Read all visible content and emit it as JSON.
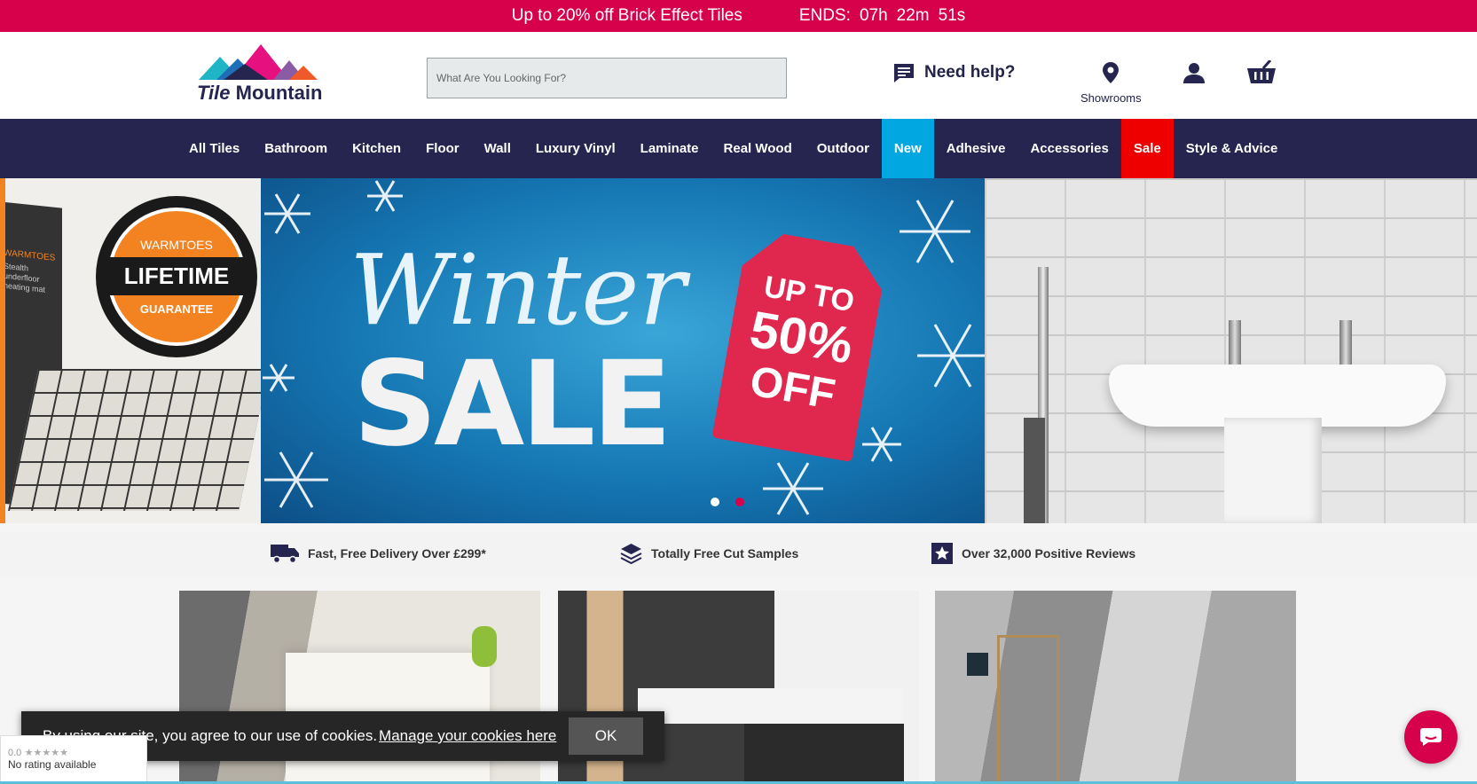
{
  "promo": {
    "text": "Up to 20% off Brick Effect Tiles",
    "ends_label": "ENDS:",
    "hours": "07h",
    "minutes": "22m",
    "seconds": "51s",
    "background": "#d6004b"
  },
  "header": {
    "logo_word1": "Tile",
    "logo_word2": "Mountain",
    "search_placeholder": "What Are You Looking For?",
    "help_label": "Need help?",
    "showrooms_label": "Showrooms",
    "icons": [
      "chat-icon",
      "map-pin-icon",
      "user-icon",
      "basket-icon"
    ]
  },
  "nav": {
    "items": [
      "All Tiles",
      "Bathroom",
      "Kitchen",
      "Floor",
      "Wall",
      "Luxury Vinyl",
      "Laminate",
      "Real Wood",
      "Outdoor",
      "New",
      "Adhesive",
      "Accessories",
      "Sale",
      "Style & Advice"
    ],
    "background": "#252550",
    "new_color": "#00a7e1",
    "sale_color": "#ee0000"
  },
  "hero": {
    "left_slide": {
      "brand": "WARMTOES",
      "badge_main": "LIFETIME",
      "badge_sub": "GUARANTEE",
      "box_brand": "WARMTOES",
      "box_text": "Stealth underfloor heating mat"
    },
    "main_slide": {
      "script": "Winter",
      "headline": "SALE",
      "tag_line1": "UP TO",
      "tag_line2": "50%",
      "tag_line3": "OFF"
    },
    "slide_count": 3,
    "active_index": 1
  },
  "usp": {
    "items": [
      {
        "icon": "truck-icon",
        "text": "Fast, Free Delivery Over £299*"
      },
      {
        "icon": "layers-icon",
        "text": "Totally Free Cut Samples"
      },
      {
        "icon": "star-icon",
        "text": "Over 32,000 Positive Reviews"
      }
    ]
  },
  "cookie": {
    "text": "By using our site, you agree to our use of cookies.",
    "link": "Manage your cookies here",
    "ok": "OK"
  },
  "rating_widget": {
    "score": "0.0",
    "stars": "★★★★★",
    "status": "No rating available"
  }
}
